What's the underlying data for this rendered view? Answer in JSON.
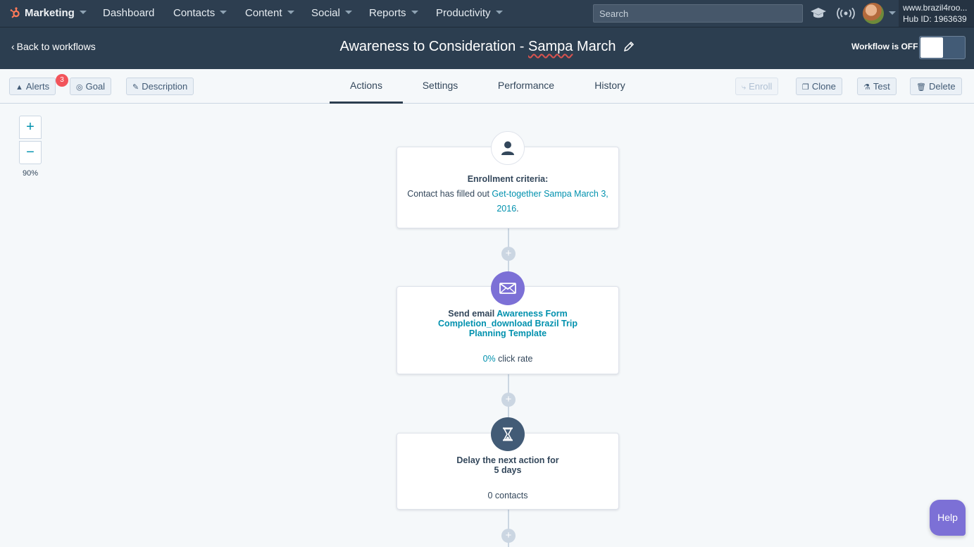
{
  "nav": {
    "brand": "Marketing",
    "items": [
      {
        "label": "Dashboard",
        "dropdown": false
      },
      {
        "label": "Contacts",
        "dropdown": true
      },
      {
        "label": "Content",
        "dropdown": true
      },
      {
        "label": "Social",
        "dropdown": true
      },
      {
        "label": "Reports",
        "dropdown": true
      },
      {
        "label": "Productivity",
        "dropdown": true
      }
    ],
    "search_placeholder": "Search",
    "account_domain": "www.brazil4roo...",
    "hub_id": "Hub ID: 1963639"
  },
  "header": {
    "back_label": "Back to workflows",
    "title_main": "Awareness to Consideration - ",
    "title_sampa": "Sampa",
    "title_end": " March",
    "status_label": "Workflow is OFF",
    "workflow_on": false
  },
  "toolbar": {
    "alerts_label": "Alerts",
    "alerts_count": "3",
    "goal_label": "Goal",
    "description_label": "Description",
    "enroll_label": "Enroll",
    "clone_label": "Clone",
    "test_label": "Test",
    "delete_label": "Delete"
  },
  "tabs": [
    {
      "label": "Actions",
      "active": true
    },
    {
      "label": "Settings",
      "active": false
    },
    {
      "label": "Performance",
      "active": false
    },
    {
      "label": "History",
      "active": false
    }
  ],
  "zoom": {
    "in": "+",
    "out": "−",
    "level": "90%"
  },
  "workflow": {
    "add_symbol": "+",
    "enrollment": {
      "heading": "Enrollment criteria:",
      "prefix": "Contact has filled out ",
      "form_link": "Get-together Sampa March 3, 2016",
      "suffix": "."
    },
    "email": {
      "prefix": "Send email ",
      "email_link": "Awareness Form Completion_download Brazil Trip Planning Template",
      "rate_value": "0%",
      "rate_label": " click rate",
      "icon_color": "#7c70d6"
    },
    "delay": {
      "line1": "Delay the next action for",
      "line2": "5 days",
      "contacts": "0 contacts",
      "icon_color": "#425b76"
    }
  },
  "help_label": "Help",
  "colors": {
    "nav_bg": "#2d3e50",
    "link": "#0091ae",
    "badge": "#f2545b",
    "help": "#7c70d6"
  }
}
